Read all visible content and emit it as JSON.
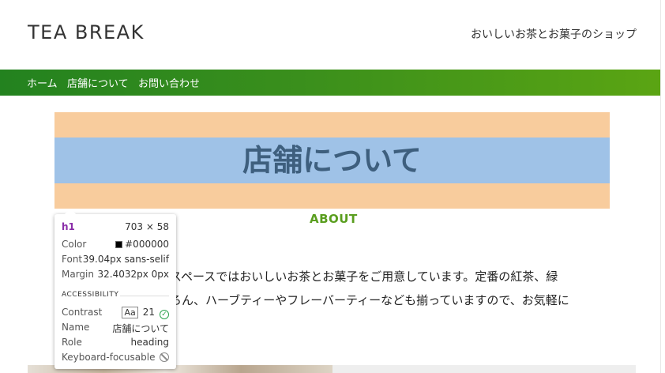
{
  "header": {
    "logo": "TEA BREAK",
    "tagline": "おいしいお茶とお菓子のショップ"
  },
  "nav": {
    "items": [
      "ホーム",
      "店舗について",
      "お問い合わせ"
    ]
  },
  "main": {
    "title": "店舗について",
    "section_label": "ABOUT",
    "body_line1": "スペースではおいしいお茶とお菓子をご用意しています。定番の紅茶、緑",
    "body_line2": "ろん、ハーブティーやフレーバーティーなども揃っていますので、お気軽に"
  },
  "inspector": {
    "tag": "h1",
    "dimensions": "703 × 58",
    "color_label": "Color",
    "color_value": "#000000",
    "font_label": "Font",
    "font_value": "39.04px sans-selif",
    "margin_label": "Margin",
    "margin_value": "32.4032px 0px",
    "accessibility_heading": "ACCESSIBILITY",
    "contrast_label": "Contrast",
    "contrast_aa": "Aa",
    "contrast_value": "21",
    "name_label": "Name",
    "name_value": "店舗について",
    "role_label": "Role",
    "role_value": "heading",
    "keyboard_label": "Keyboard-focusable"
  },
  "colors": {
    "nav_gradient_start": "#23821f",
    "nav_gradient_end": "#5ba513",
    "title_margin_overlay": "#f8cc9d",
    "title_content_overlay": "#9fc2e7",
    "title_text": "#3e5f7e",
    "about_green": "#5a9e1f"
  },
  "icons": {
    "contrast_pass": "check-circle-icon",
    "not_focusable": "block-icon"
  }
}
